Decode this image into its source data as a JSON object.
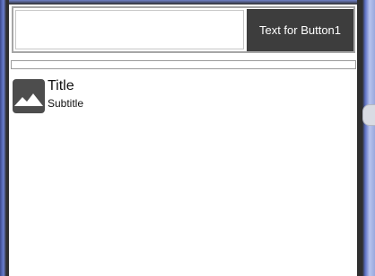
{
  "top_bar": {
    "text_field_value": "",
    "button_label": "Text for Button1"
  },
  "list": {
    "items": [
      {
        "icon": "image-placeholder-icon",
        "title": "Title",
        "subtitle": "Subtitle"
      }
    ]
  },
  "colors": {
    "button_bg": "#3d3d3d",
    "thumbnail_bg": "#4d4d4d",
    "device_accent": "#6a7fd0"
  }
}
